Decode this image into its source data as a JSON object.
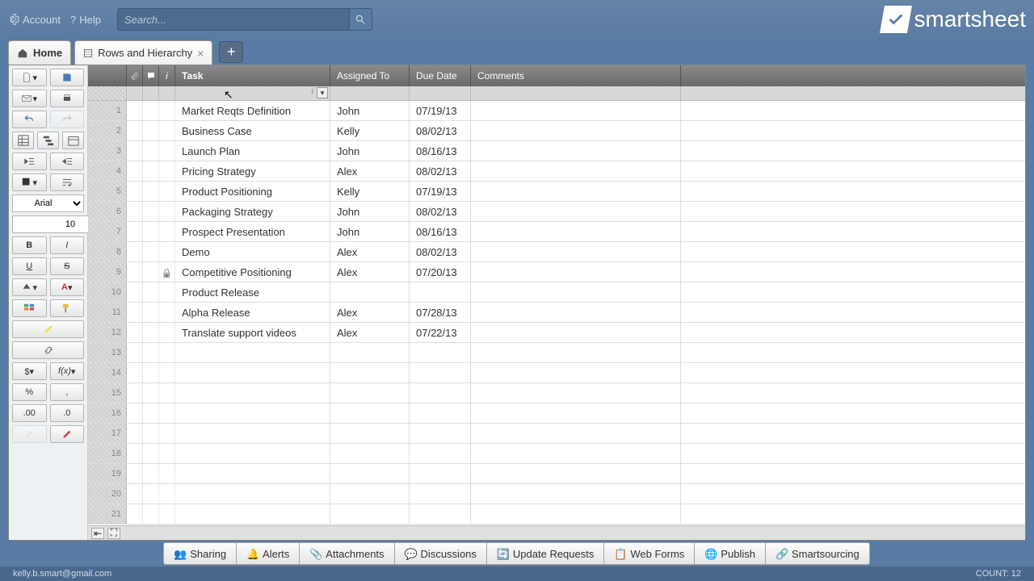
{
  "topbar": {
    "account": "Account",
    "help": "Help",
    "search_placeholder": "Search..."
  },
  "tabs": {
    "home": "Home",
    "active": "Rows and Hierarchy"
  },
  "toolbar": {
    "font": "Arial",
    "font_size": "10"
  },
  "columns": {
    "task": "Task",
    "assigned": "Assigned To",
    "due": "Due Date",
    "comments": "Comments"
  },
  "rows": [
    {
      "n": "1",
      "task": "Market Reqts Definition",
      "assigned": "John",
      "due": "07/19/13",
      "lock": false
    },
    {
      "n": "2",
      "task": "Business Case",
      "assigned": "Kelly",
      "due": "08/02/13",
      "lock": false
    },
    {
      "n": "3",
      "task": "Launch Plan",
      "assigned": "John",
      "due": "08/16/13",
      "lock": false
    },
    {
      "n": "4",
      "task": "Pricing Strategy",
      "assigned": "Alex",
      "due": "08/02/13",
      "lock": false
    },
    {
      "n": "5",
      "task": "Product Positioning",
      "assigned": "Kelly",
      "due": "07/19/13",
      "lock": false
    },
    {
      "n": "6",
      "task": "Packaging Strategy",
      "assigned": "John",
      "due": "08/02/13",
      "lock": false
    },
    {
      "n": "7",
      "task": "Prospect Presentation",
      "assigned": "John",
      "due": "08/16/13",
      "lock": false
    },
    {
      "n": "8",
      "task": "Demo",
      "assigned": "Alex",
      "due": "08/02/13",
      "lock": false
    },
    {
      "n": "9",
      "task": "Competitive Positioning",
      "assigned": "Alex",
      "due": "07/20/13",
      "lock": true
    },
    {
      "n": "10",
      "task": "Product Release",
      "assigned": "",
      "due": "",
      "lock": false
    },
    {
      "n": "11",
      "task": "Alpha Release",
      "assigned": "Alex",
      "due": "07/28/13",
      "lock": false
    },
    {
      "n": "12",
      "task": "Translate support videos",
      "assigned": "Alex",
      "due": "07/22/13",
      "lock": false
    },
    {
      "n": "13",
      "task": "",
      "assigned": "",
      "due": "",
      "lock": false
    },
    {
      "n": "14",
      "task": "",
      "assigned": "",
      "due": "",
      "lock": false
    },
    {
      "n": "15",
      "task": "",
      "assigned": "",
      "due": "",
      "lock": false
    },
    {
      "n": "16",
      "task": "",
      "assigned": "",
      "due": "",
      "lock": false
    },
    {
      "n": "17",
      "task": "",
      "assigned": "",
      "due": "",
      "lock": false
    },
    {
      "n": "18",
      "task": "",
      "assigned": "",
      "due": "",
      "lock": false
    },
    {
      "n": "19",
      "task": "",
      "assigned": "",
      "due": "",
      "lock": false
    },
    {
      "n": "20",
      "task": "",
      "assigned": "",
      "due": "",
      "lock": false
    },
    {
      "n": "21",
      "task": "",
      "assigned": "",
      "due": "",
      "lock": false
    }
  ],
  "bottom": {
    "sharing": "Sharing",
    "alerts": "Alerts",
    "attachments": "Attachments",
    "discussions": "Discussions",
    "update_requests": "Update Requests",
    "web_forms": "Web Forms",
    "publish": "Publish",
    "smartsourcing": "Smartsourcing"
  },
  "status": {
    "email": "kelly.b.smart@gmail.com",
    "count": "COUNT: 12"
  },
  "logo": "smartsheet"
}
